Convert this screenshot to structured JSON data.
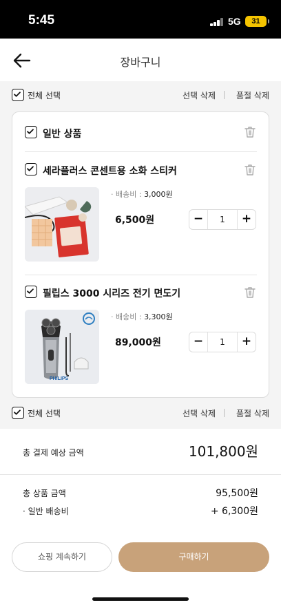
{
  "status_bar": {
    "time": "5:45",
    "network": "5G",
    "battery": "31"
  },
  "header": {
    "title": "장바구니",
    "back_icon": "arrow-left-icon"
  },
  "select_bar": {
    "select_all": "전체 선택",
    "delete_selected": "선택 삭제",
    "delete_soldout": "품절 삭제"
  },
  "cart": {
    "group_title": "일반 상품",
    "items": [
      {
        "name": "세라플러스 콘센트용 소화 스티커",
        "shipping_label": "· 배송비 :",
        "shipping_fee": "3,000원",
        "price": "6,500원",
        "quantity": "1",
        "image": "fire-extinguishing-sticker-product-image"
      },
      {
        "name": "필립스 3000 시리즈 전기 면도기",
        "shipping_label": "· 배송비 :",
        "shipping_fee": "3,300원",
        "price": "89,000원",
        "quantity": "1",
        "image": "philips-shaver-product-image",
        "image_brand": "PHILIPS"
      }
    ]
  },
  "summary": {
    "total_label": "총 결제 예상 금액",
    "total_value": "101,800원",
    "product_total_label": "총 상품 금액",
    "product_total_value": "95,500원",
    "shipping_label": "· 일반 배송비",
    "shipping_value": "+ 6,300원"
  },
  "buttons": {
    "continue_shopping": "쇼핑 계속하기",
    "buy": "구매하기"
  },
  "colors": {
    "accent": "#c8a27a",
    "page_bg": "#f4f4f4"
  }
}
